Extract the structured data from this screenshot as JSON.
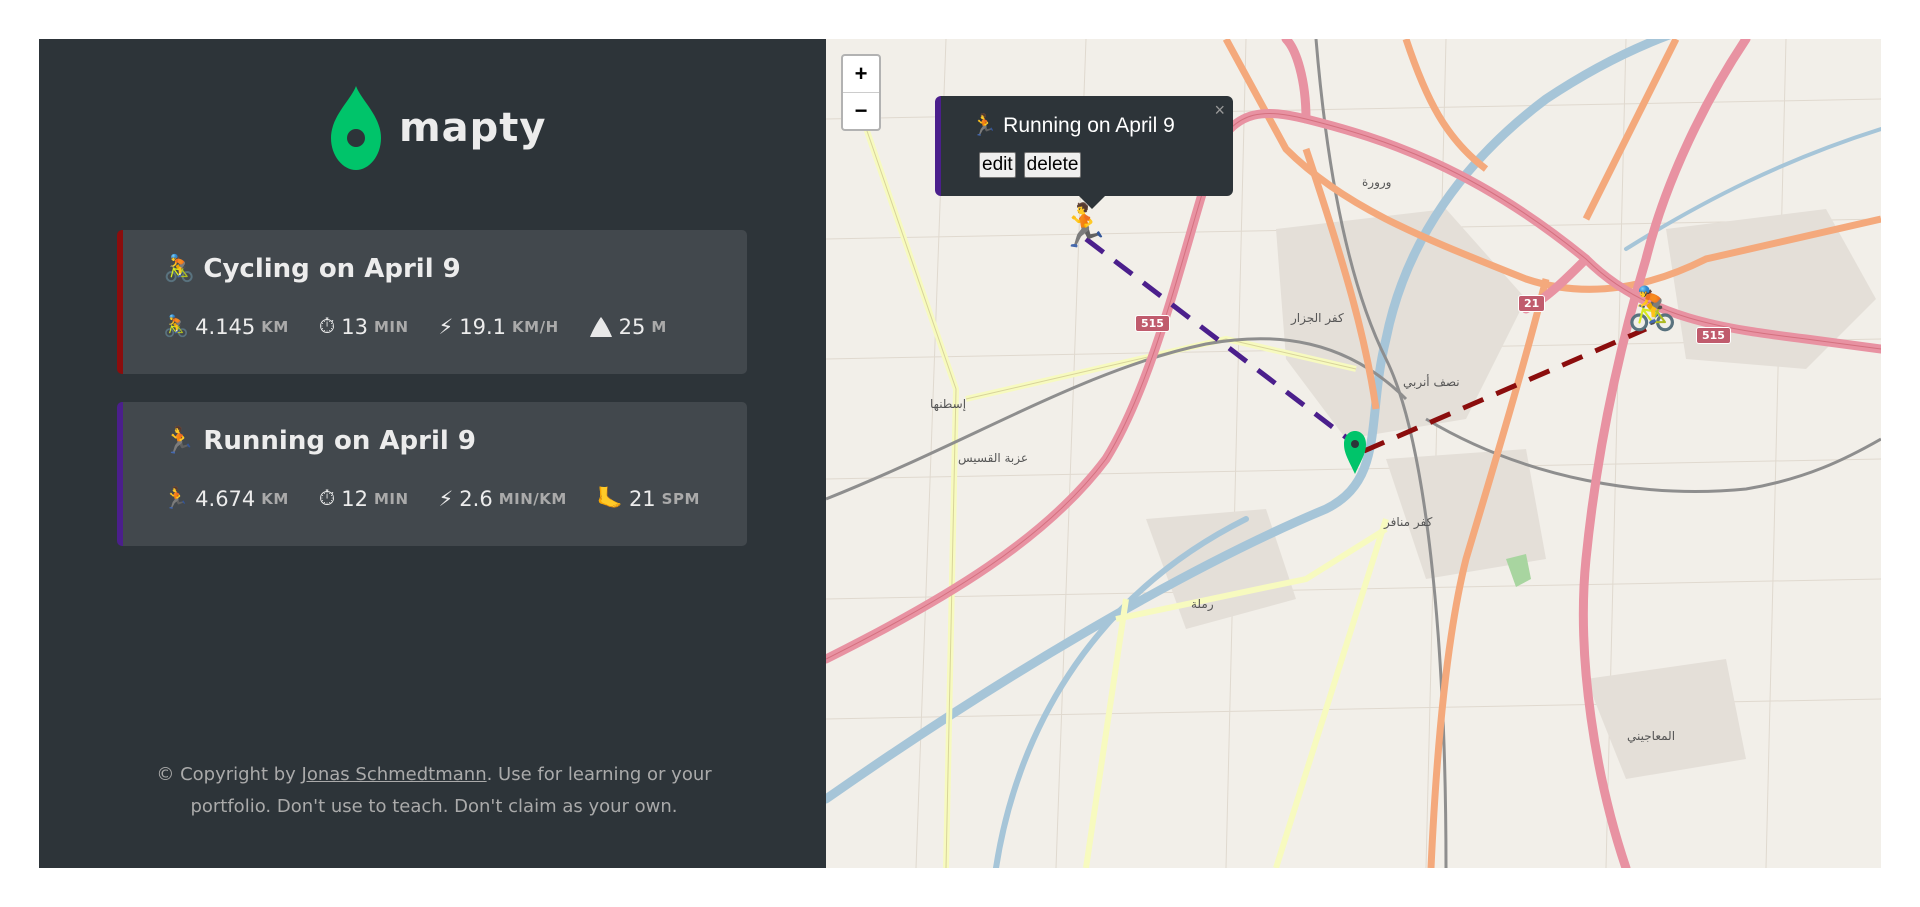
{
  "brand": {
    "name": "mapty",
    "accent": "#00c46a"
  },
  "workouts": [
    {
      "type": "cycling",
      "title": "Cycling on April 9",
      "color": "#8b0d0d",
      "stats": [
        {
          "icon": "bike-icon",
          "value": "4.145",
          "unit": "km"
        },
        {
          "icon": "stopwatch-icon",
          "value": "13",
          "unit": "min"
        },
        {
          "icon": "lightning-icon",
          "value": "19.1",
          "unit": "km/h"
        },
        {
          "icon": "mountain-icon",
          "value": "25",
          "unit": "m"
        }
      ]
    },
    {
      "type": "running",
      "title": "Running on April 9",
      "color": "#4b1f8c",
      "stats": [
        {
          "icon": "runner-icon",
          "value": "4.674",
          "unit": "km"
        },
        {
          "icon": "stopwatch-icon",
          "value": "12",
          "unit": "min"
        },
        {
          "icon": "lightning-icon",
          "value": "2.6",
          "unit": "min/km"
        },
        {
          "icon": "footprint-icon",
          "value": "21",
          "unit": "spm"
        }
      ]
    }
  ],
  "footer": {
    "prefix": "© Copyright by ",
    "author": "Jonas Schmedtmann",
    "suffix": ". Use for learning or your portfolio. Don't use to teach. Don't claim as your own."
  },
  "map": {
    "zoom_in": "+",
    "zoom_out": "−",
    "popup": {
      "title": "Running on April 9",
      "close": "×",
      "edit": "edit",
      "delete": "delete"
    },
    "labels": [
      "ورورة",
      "كفر الجزار",
      "إسطنها",
      "عزبة القسيس",
      "كفر منافر",
      "رملة",
      "نصف أنربي",
      "المعاجيني"
    ],
    "shields": [
      "515",
      "21",
      "515"
    ]
  }
}
